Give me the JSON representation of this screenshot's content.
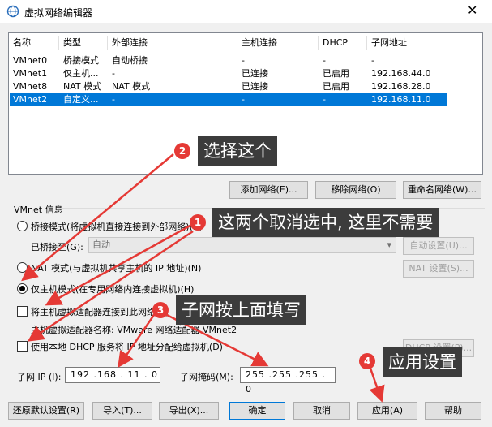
{
  "window": {
    "title": "虚拟网络编辑器",
    "close_glyph": "✕"
  },
  "table": {
    "headers": [
      "名称",
      "类型",
      "外部连接",
      "主机连接",
      "DHCP",
      "子网地址"
    ],
    "rows": [
      [
        "VMnet0",
        "桥接模式",
        "自动桥接",
        "-",
        "-",
        "-"
      ],
      [
        "VMnet1",
        "仅主机...",
        "-",
        "已连接",
        "已启用",
        "192.168.44.0"
      ],
      [
        "VMnet8",
        "NAT 模式",
        "NAT 模式",
        "已连接",
        "已启用",
        "192.168.28.0"
      ],
      [
        "VMnet2",
        "自定义...",
        "-",
        "-",
        "-",
        "192.168.11.0"
      ]
    ],
    "selected_row": 3
  },
  "table_buttons": {
    "add": "添加网络(E)...",
    "remove": "移除网络(O)",
    "rename": "重命名网络(W)..."
  },
  "vmnet_info": {
    "group_label": "VMnet 信息",
    "bridge_mode": "桥接模式(将虚拟机直接连接到外部网络)(B)",
    "bridged_to_label": "已桥接至(G):",
    "bridged_to_value": "自动",
    "auto_settings": "自动设置(U)...",
    "nat_mode": "NAT 模式(与虚拟机共享主机的 IP 地址)(N)",
    "nat_settings": "NAT 设置(S)...",
    "host_only": "仅主机模式(在专用网络内连接虚拟机)(H)",
    "connect_adapter": "将主机虚拟适配器连接到此网络(V)",
    "adapter_name": "主机虚拟适配器名称: VMware 网络适配器 VMnet2",
    "use_dhcp": "使用本地 DHCP 服务将 IP 地址分配给虚拟机(D)",
    "dhcp_settings": "DHCP 设置(P)...",
    "subnet_ip_label": "子网 IP (I):",
    "subnet_ip": "192 .168 . 11 . 0",
    "subnet_mask_label": "子网掩码(M):",
    "subnet_mask": "255 .255 .255 . 0"
  },
  "footer_buttons": {
    "restore": "还原默认设置(R)",
    "import": "导入(T)...",
    "export": "导出(X)...",
    "ok": "确定",
    "cancel": "取消",
    "apply": "应用(A)",
    "help": "帮助"
  },
  "annotations": [
    {
      "num": "1",
      "text": "这两个取消选中, 这里不需要"
    },
    {
      "num": "2",
      "text": "选择这个"
    },
    {
      "num": "3",
      "text": "子网按上面填写"
    },
    {
      "num": "4",
      "text": "应用设置"
    }
  ],
  "colors": {
    "selection": "#0078d7",
    "annotation_red": "#e53935",
    "callout_bg": "#3c3c3c"
  }
}
